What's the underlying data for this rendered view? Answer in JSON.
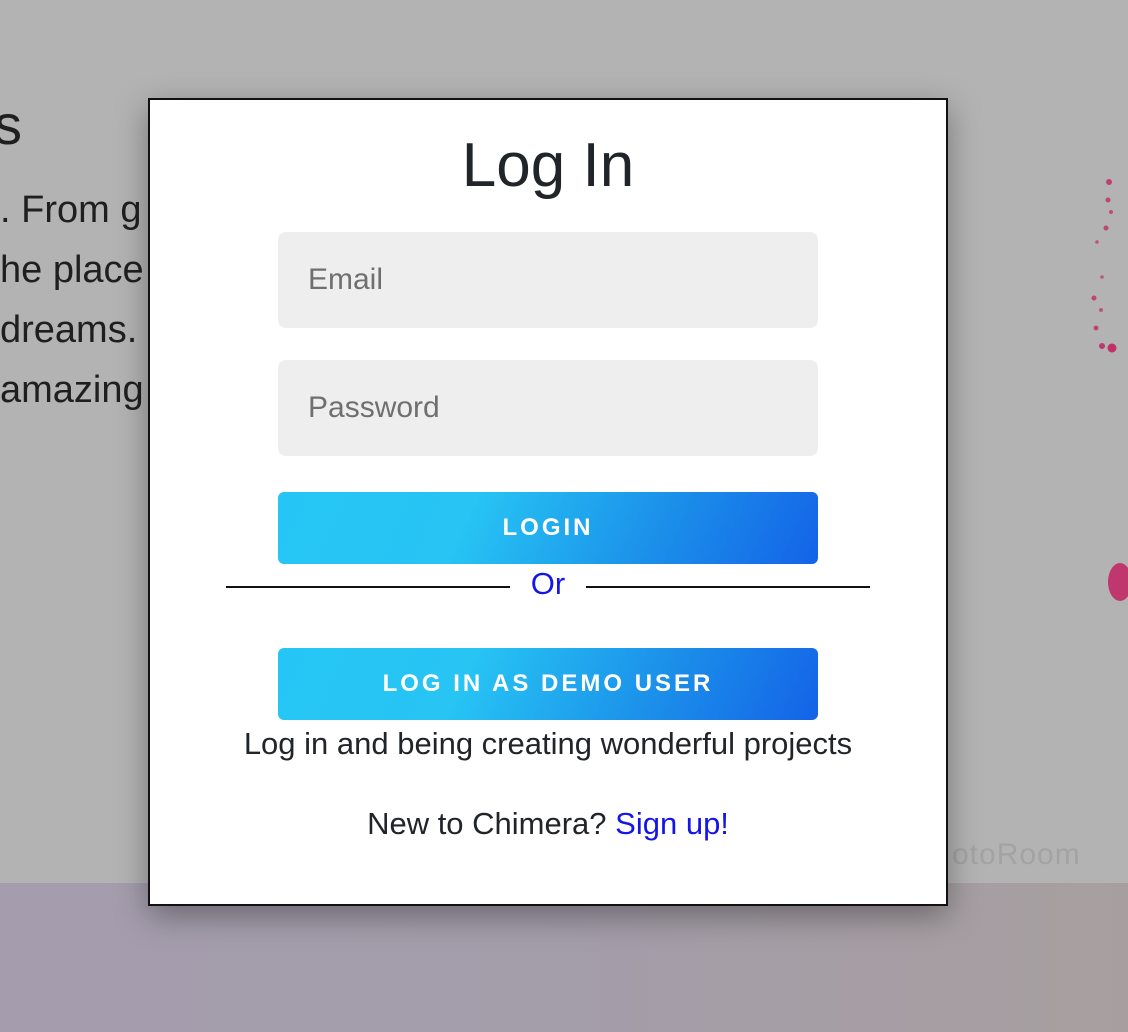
{
  "background": {
    "heading_fragment": "s",
    "text_lines": [
      ". From g",
      "he place",
      "dreams.",
      "amazing"
    ],
    "watermark": "otoRoom",
    "colors": {
      "overlay": "#b3b3b3",
      "accent_splash": "#c2185b"
    }
  },
  "modal": {
    "title": "Log In",
    "email": {
      "placeholder": "Email",
      "value": ""
    },
    "password": {
      "placeholder": "Password",
      "value": ""
    },
    "login_button": "LOGIN",
    "divider_text": "Or",
    "demo_button": "LOG IN AS DEMO USER",
    "tagline": "Log in and being creating wonderful projects",
    "signup_prompt": "New to Chimera?",
    "signup_link": "Sign up!",
    "colors": {
      "button_gradient_start": "#25c6f5",
      "button_gradient_end": "#1463e8",
      "link": "#1515e8",
      "field_background": "#eeeeee"
    }
  }
}
